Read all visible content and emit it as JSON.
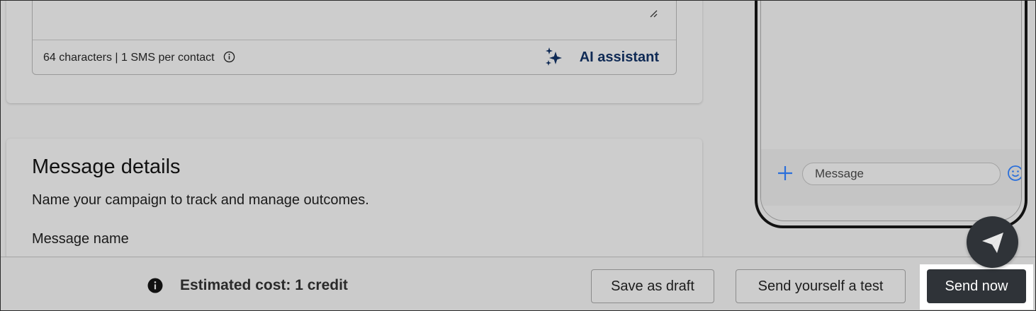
{
  "editor": {
    "char_count": "64 characters | 1 SMS per contact",
    "ai_assistant_label": "AI assistant"
  },
  "message_details": {
    "title": "Message details",
    "subtitle": "Name your campaign to track and manage outcomes.",
    "message_name_label": "Message name"
  },
  "phone_preview": {
    "message_placeholder": "Message"
  },
  "action_bar": {
    "estimated_cost": "Estimated cost: 1 credit",
    "save_draft_label": "Save as draft",
    "send_test_label": "Send yourself a test",
    "send_now_label": "Send now"
  },
  "icons": {
    "info": "info-outline-icon",
    "sparkle": "sparkle-icon",
    "plus": "plus-icon",
    "emoji": "emoji-icon",
    "send": "paper-plane-icon",
    "resize": "resize-handle-icon"
  },
  "colors": {
    "ai_text": "#0f2a55",
    "primary_button": "#2f3338",
    "phone_accent": "#2a6fdb"
  }
}
